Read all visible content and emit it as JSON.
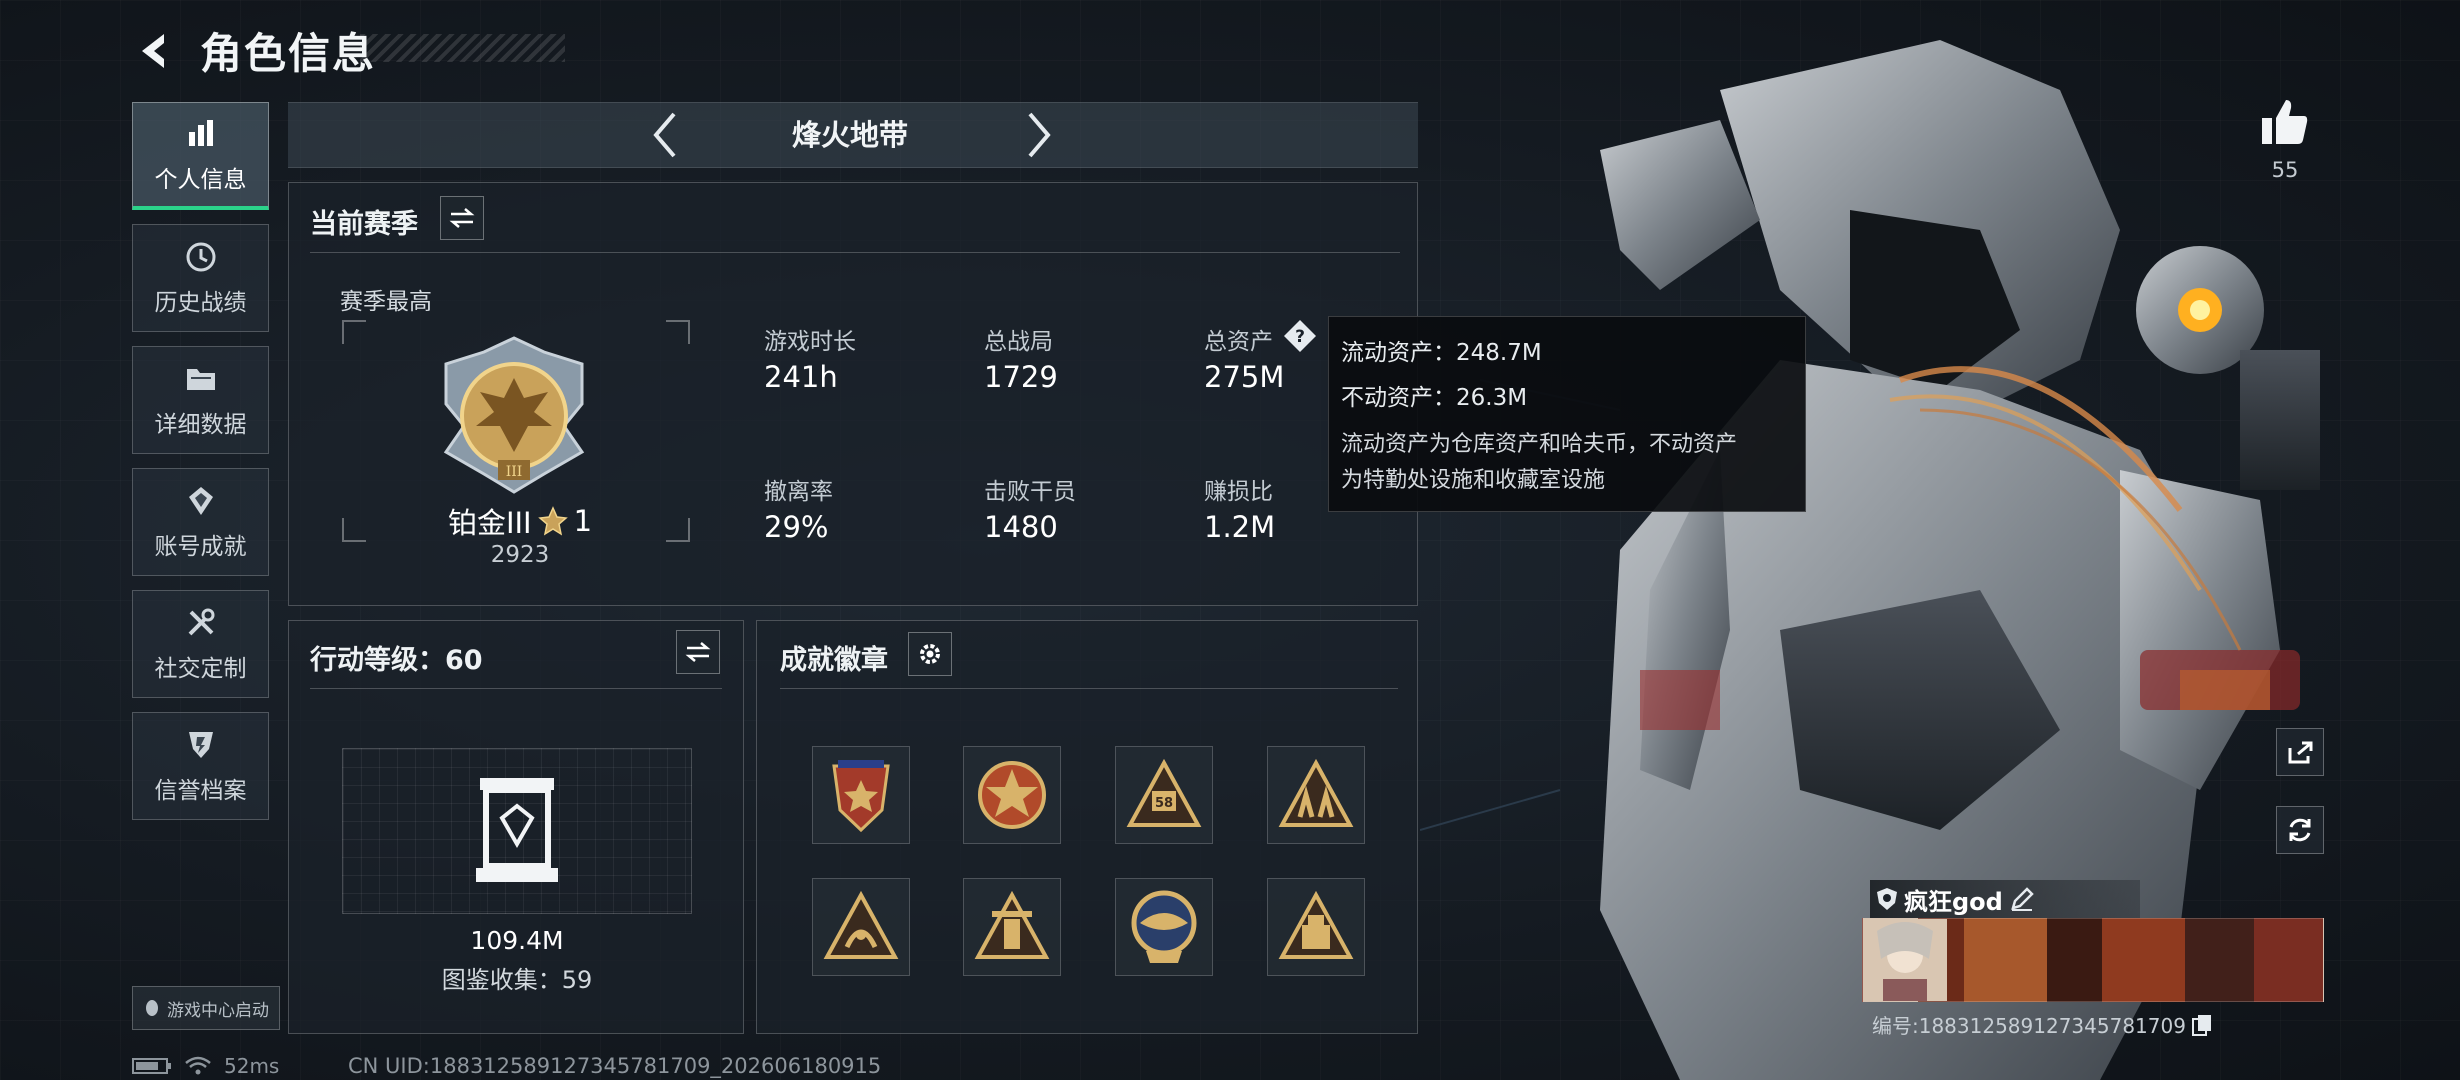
{
  "header": {
    "title": "角色信息"
  },
  "sidebar": {
    "items": [
      {
        "label": "个人信息",
        "icon": "bar-chart-icon",
        "active": true
      },
      {
        "label": "历史战绩",
        "icon": "history-icon",
        "active": false
      },
      {
        "label": "详细数据",
        "icon": "folder-icon",
        "active": false
      },
      {
        "label": "账号成就",
        "icon": "achievement-icon",
        "active": false
      },
      {
        "label": "社交定制",
        "icon": "tools-icon",
        "active": false
      },
      {
        "label": "信誉档案",
        "icon": "credit-shield-icon",
        "active": false
      }
    ],
    "game_center_label": "游戏中心启动"
  },
  "status_bar": {
    "ping": "52ms",
    "uid": "CN UID:18831258912734578170​9_202606180915"
  },
  "mode_selector": {
    "label": "烽火地带"
  },
  "season_panel": {
    "title": "当前赛季",
    "season_best_label": "赛季最高",
    "rank_name": "铂金III",
    "rank_stars": "1",
    "rank_score": "2923",
    "stats": [
      {
        "label": "游戏时长",
        "value": "241h"
      },
      {
        "label": "总战局",
        "value": "1729"
      },
      {
        "label": "总资产",
        "value": "275M"
      },
      {
        "label": "撤离率",
        "value": "29%"
      },
      {
        "label": "击败干员",
        "value": "1480"
      },
      {
        "label": "赚损比",
        "value": "1.2M"
      }
    ]
  },
  "tooltip": {
    "liquid_assets": "流动资产：248.7M",
    "fixed_assets": "不动资产：26.3M",
    "description_line1": "流动资产为仓库资产和哈夫币，不动资产",
    "description_line2": "为特勤处设施和收藏室设施"
  },
  "action_panel": {
    "title": "行动等级：60",
    "value": "109.4M",
    "collection": "图鉴收集：59"
  },
  "badges_panel": {
    "title": "成就徽章",
    "badges": [
      "badge-shield-star",
      "badge-star-circle",
      "badge-triangle-58",
      "badge-triangle-figures",
      "badge-triangle-claw",
      "badge-triangle-tower",
      "badge-circle-wing",
      "badge-triangle-block"
    ]
  },
  "likes": {
    "count": "55"
  },
  "player": {
    "name": "疯狂god",
    "id": "编号:18831258912734578170​9"
  },
  "colors": {
    "accent": "#2bd38a",
    "gold": "#c9a25a",
    "bg": "#161c23"
  }
}
